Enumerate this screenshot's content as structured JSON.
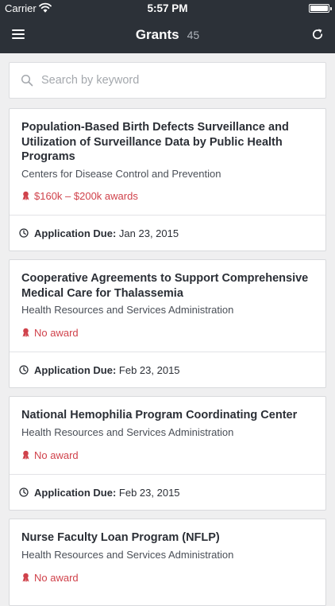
{
  "status_bar": {
    "carrier": "Carrier",
    "time": "5:57 PM"
  },
  "navbar": {
    "title": "Grants",
    "count": "45"
  },
  "search": {
    "placeholder": "Search by keyword"
  },
  "due_label": "Application Due:",
  "grants": [
    {
      "title": "Population-Based Birth Defects Surveillance and Utilization of Surveillance Data by Public Health Programs",
      "agency": "Centers for Disease Control and Prevention",
      "award": "$160k – $200k awards",
      "due": "Jan 23, 2015"
    },
    {
      "title": "Cooperative Agreements to Support Comprehensive Medical Care for Thalassemia",
      "agency": "Health Resources and Services Administration",
      "award": "No award",
      "due": "Feb 23, 2015"
    },
    {
      "title": "National Hemophilia Program Coordinating Center",
      "agency": "Health Resources and Services Administration",
      "award": "No award",
      "due": "Feb 23, 2015"
    },
    {
      "title": "Nurse Faculty Loan Program (NFLP)",
      "agency": "Health Resources and Services Administration",
      "award": "No award",
      "due": ""
    }
  ],
  "colors": {
    "navbar": "#2c3138",
    "award": "#d0424b",
    "background": "#efeff0"
  },
  "icons": [
    "menu-icon",
    "refresh-icon",
    "search-icon",
    "award-icon",
    "clock-icon",
    "wifi-icon",
    "battery-icon"
  ]
}
